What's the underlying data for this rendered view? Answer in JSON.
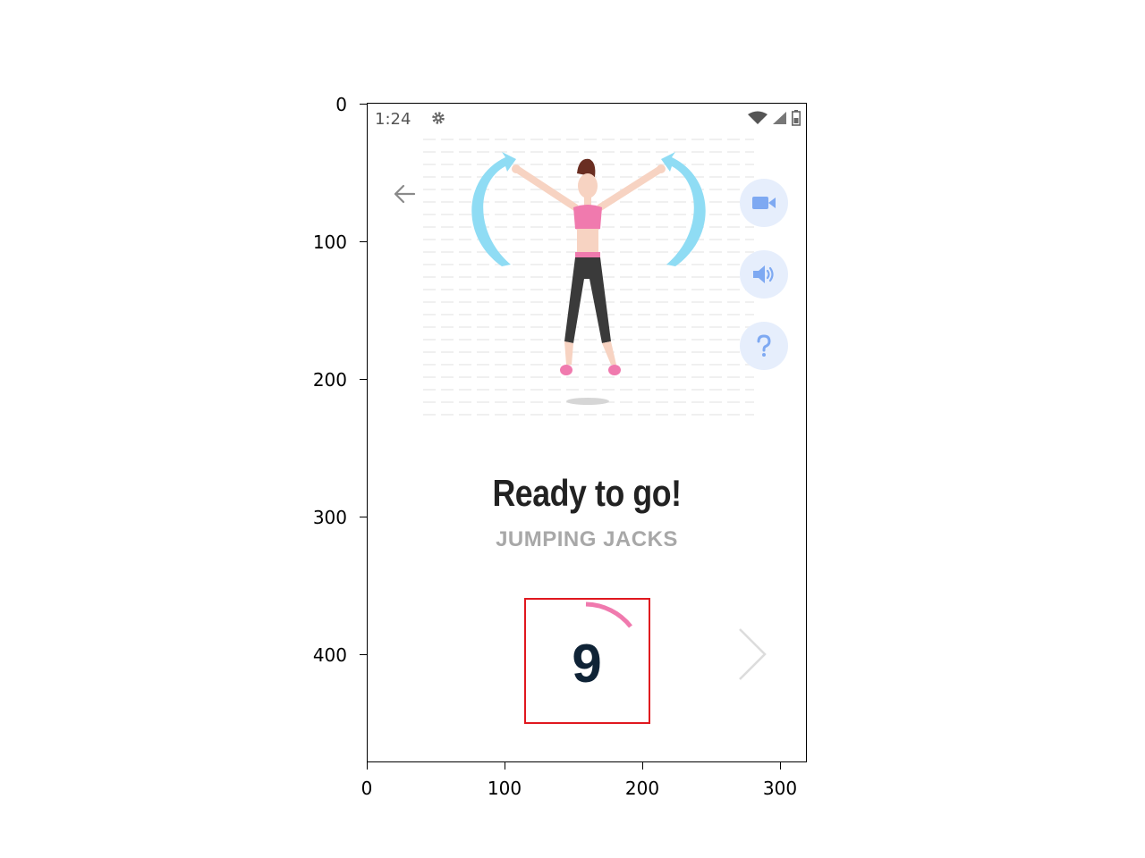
{
  "status_bar": {
    "time": "1:24",
    "settings_icon": "gear-icon",
    "wifi_icon": "wifi-icon",
    "signal_icon": "signal-icon",
    "battery_icon": "battery-icon"
  },
  "toolbar": {
    "back_icon": "arrow-left-icon"
  },
  "side_actions": [
    {
      "name": "video",
      "icon": "video-camera-icon"
    },
    {
      "name": "sound",
      "icon": "speaker-icon"
    },
    {
      "name": "help",
      "icon": "question-icon"
    }
  ],
  "exercise": {
    "heading": "Ready to go!",
    "name": "JUMPING JACKS"
  },
  "countdown": {
    "value": "9"
  },
  "navigation": {
    "next_icon": "chevron-right-icon"
  },
  "axes": {
    "y_ticks": [
      "0",
      "100",
      "200",
      "300",
      "400"
    ],
    "x_ticks": [
      "0",
      "100",
      "200",
      "300"
    ]
  },
  "colors": {
    "accent_pink": "#f07aae",
    "arrow_blue": "#8fdcf4",
    "fab_bg": "#e6eefc",
    "fab_icon": "#7ea9f2",
    "highlight": "#e0181f"
  }
}
